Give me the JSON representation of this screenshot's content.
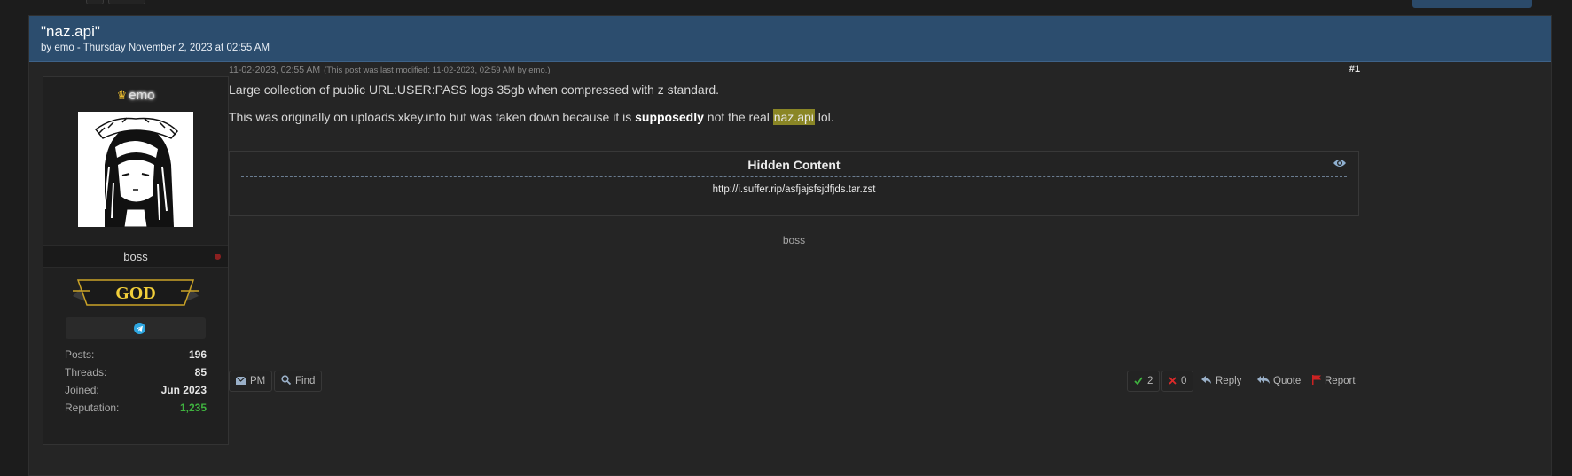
{
  "thread": {
    "title": "\"naz.api\"",
    "subtitle": "by emo - Thursday November 2, 2023 at 02:55 AM"
  },
  "author": {
    "username": "emo",
    "user_title": "boss",
    "rank_badge": "GOD",
    "stats": [
      {
        "label": "Posts:",
        "value": "196"
      },
      {
        "label": "Threads:",
        "value": "85"
      },
      {
        "label": "Joined:",
        "value": "Jun 2023"
      },
      {
        "label": "Reputation:",
        "value": "1,235"
      }
    ]
  },
  "post": {
    "date": "11-02-2023, 02:55 AM",
    "modified_note": "(This post was last modified: 11-02-2023, 02:59 AM by emo.)",
    "number": "#1",
    "line1": "Large collection of public URL:USER:PASS logs 35gb when compressed with z standard.",
    "line2_a": "This was originally on uploads.xkey.info but was taken down because it is ",
    "line2_bold": "supposedly",
    "line2_b": " not the real ",
    "line2_highlight": "naz.api",
    "line2_c": " lol.",
    "hidden_title": "Hidden Content",
    "hidden_link": "http://i.suffer.rip/asfjajsfsjdfjds.tar.zst",
    "signature": "boss"
  },
  "actions": {
    "pm": "PM",
    "find": "Find",
    "upvotes": "2",
    "downvotes": "0",
    "reply": "Reply",
    "quote": "Quote",
    "report": "Report"
  },
  "colors": {
    "header_bg": "#2c4d6e",
    "reputation": "#3fb23f",
    "highlight": "#8a8626",
    "telegram": "#2ea6e0",
    "report_flag": "#cc2222"
  }
}
